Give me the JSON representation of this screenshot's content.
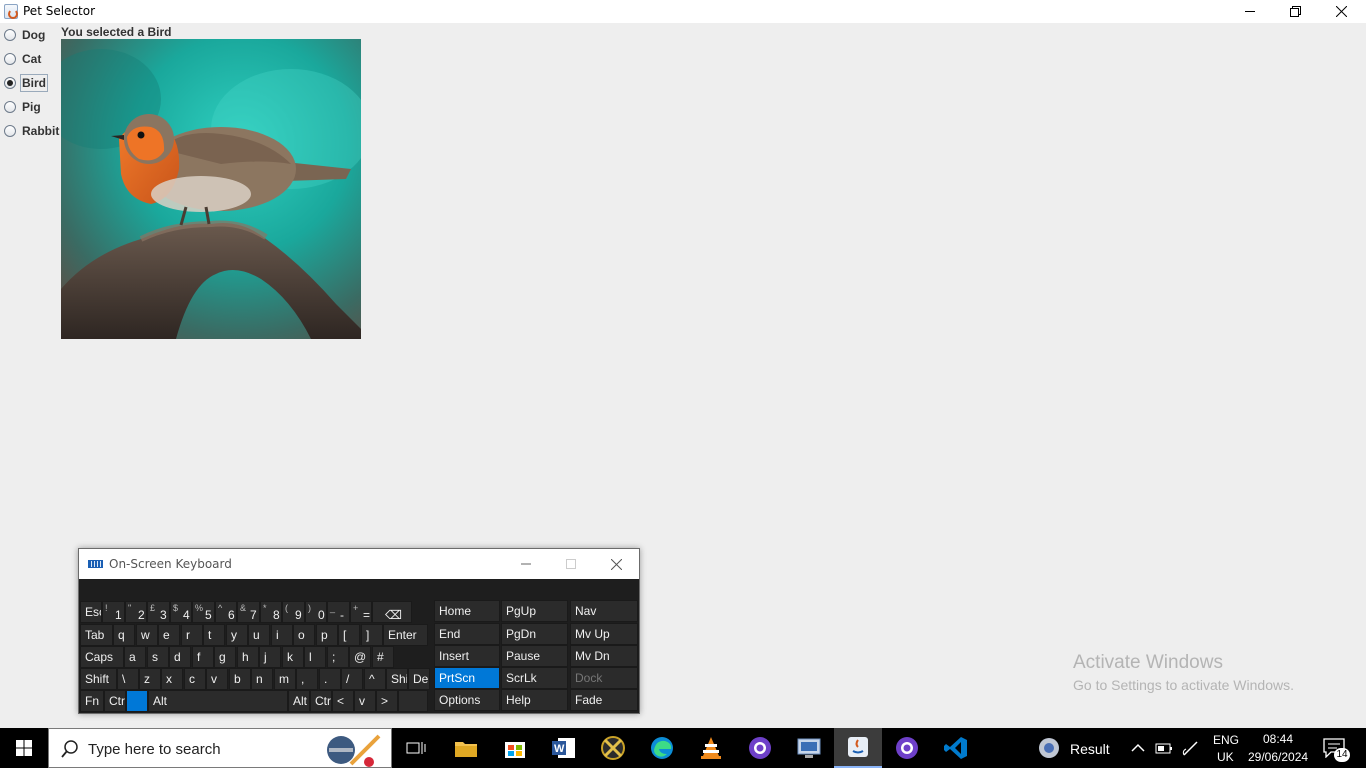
{
  "window": {
    "title": "Pet Selector",
    "controls": {
      "minimize": "minimize-icon",
      "maximize": "restore-icon",
      "close": "close-icon"
    }
  },
  "pets": [
    {
      "label": "Dog",
      "selected": false
    },
    {
      "label": "Cat",
      "selected": false
    },
    {
      "label": "Bird",
      "selected": true
    },
    {
      "label": "Pig",
      "selected": false
    },
    {
      "label": "Rabbit",
      "selected": false
    }
  ],
  "selection_text": "You selected a Bird",
  "osk": {
    "title": "On-Screen Keyboard",
    "row1": [
      "Esc",
      "1",
      "2",
      "3",
      "4",
      "5",
      "6",
      "7",
      "8",
      "9",
      "0",
      "-",
      "=",
      "⌫"
    ],
    "row1_shift": [
      "¬",
      "!",
      "\"",
      "£",
      "$",
      "%",
      "^",
      "&",
      "*",
      "(",
      ")",
      "_",
      "+",
      ""
    ],
    "row2": [
      "Tab",
      "q",
      "w",
      "e",
      "r",
      "t",
      "y",
      "u",
      "i",
      "o",
      "p",
      "[",
      "]",
      "Enter"
    ],
    "row3": [
      "Caps",
      "a",
      "s",
      "d",
      "f",
      "g",
      "h",
      "j",
      "k",
      "l",
      ";",
      "@",
      "#"
    ],
    "row4": [
      "Shift",
      "\\",
      "z",
      "x",
      "c",
      "v",
      "b",
      "n",
      "m",
      ",",
      ".",
      "/",
      "^",
      "Shi",
      "Del"
    ],
    "row5": [
      "Fn",
      "Ctr",
      "",
      "Alt",
      "Alt",
      "Ctr",
      "<",
      "v",
      ">",
      ""
    ],
    "nav_col1": [
      "Home",
      "End",
      "Insert",
      "PrtScn",
      "Options"
    ],
    "nav_col2": [
      "PgUp",
      "PgDn",
      "Pause",
      "ScrLk",
      "Help"
    ],
    "nav_col3": [
      "Nav",
      "Mv Up",
      "Mv Dn",
      "Dock",
      "Fade"
    ]
  },
  "watermark": {
    "title": "Activate Windows",
    "subtitle": "Go to Settings to activate Windows."
  },
  "taskbar": {
    "search_placeholder": "Type here to search",
    "weather_text": "Result",
    "language": "ENG",
    "region": "UK",
    "time": "08:44",
    "date": "29/06/2024",
    "notification_count": "14"
  },
  "colors": {
    "window_bg": "#eeeeee",
    "taskbar_bg": "#000000",
    "osk_bg": "#1e1e1e",
    "osk_highlight": "#0078d7"
  }
}
